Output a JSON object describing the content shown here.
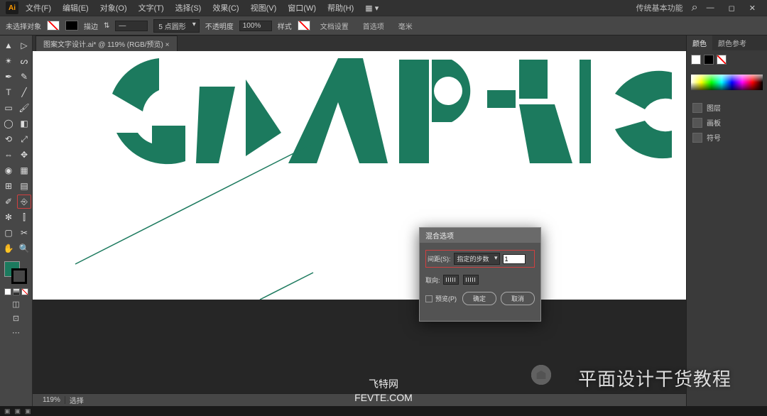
{
  "menu": {
    "items": [
      "文件(F)",
      "编辑(E)",
      "对象(O)",
      "文字(T)",
      "选择(S)",
      "效果(C)",
      "视图(V)",
      "窗口(W)",
      "帮助(H)"
    ],
    "workspace": "传统基本功能",
    "search_icon": "⌕"
  },
  "ctrl": {
    "nosel": "未选择对象",
    "stroke": "描边",
    "stroke_pt": "5 点圆形",
    "opacity": "不透明度",
    "opacity_val": "100%",
    "style": "样式",
    "doc_setup": "文档设置",
    "prefs": "首选项",
    "units": "毫米"
  },
  "tab": {
    "title": "图案文字设计.ai* @ 119% (RGB/预览)"
  },
  "dialog": {
    "title": "混合选项",
    "spacing_label": "间距(S):",
    "spacing_mode": "指定的步数",
    "spacing_value": "1",
    "orient_label": "取向:",
    "preview": "预览(P)",
    "ok": "确定",
    "cancel": "取消"
  },
  "status": {
    "zoom": "119%",
    "sel": "选择"
  },
  "right": {
    "tab_color": "颜色",
    "tab_guide": "颜色参考",
    "p_layers": "图层",
    "p_artboards": "画板",
    "p_symbols": "符号"
  },
  "footer": {
    "site": "飞特网",
    "url": "FEVTE.COM",
    "wm": "平面设计干货教程"
  },
  "canvas_text": "GRAPHIC",
  "accent": "#1c7a5e"
}
